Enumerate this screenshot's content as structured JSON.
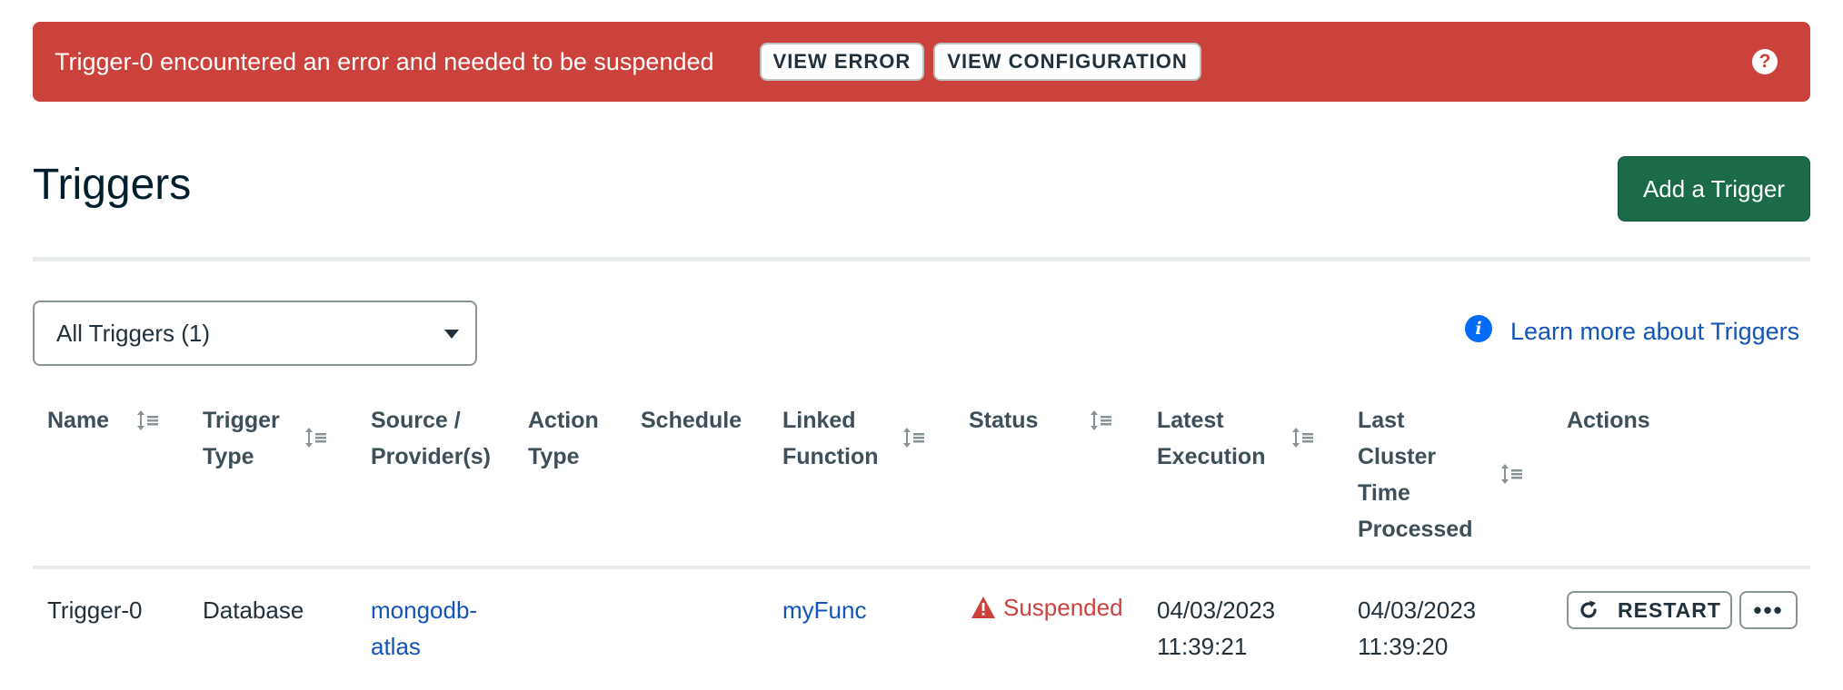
{
  "banner": {
    "message": "Trigger-0 encountered an error and needed to be suspended",
    "view_error_label": "VIEW ERROR",
    "view_config_label": "VIEW CONFIGURATION",
    "help_icon": "question-circle-icon",
    "help_glyph": "?",
    "color": "#cb413b"
  },
  "page": {
    "title": "Triggers",
    "add_button_label": "Add a Trigger",
    "accent": "#1b6b48"
  },
  "filter": {
    "selected": "All Triggers (1)"
  },
  "learn_more": {
    "icon": "info-icon",
    "glyph": "i",
    "label": "Learn more about Triggers"
  },
  "table": {
    "headers": {
      "name": "Name",
      "trigger_type": "Trigger Type",
      "source": "Source / Provider(s)",
      "action_type": "Action Type",
      "schedule": "Schedule",
      "linked_function": "Linked Function",
      "status": "Status",
      "latest_execution": "Latest Execution",
      "last_cluster_time": "Last Cluster Time Processed",
      "actions": "Actions"
    },
    "rows": [
      {
        "name": "Trigger-0",
        "trigger_type": "Database",
        "source": "mongodb-atlas",
        "source_line1": "mongodb-",
        "source_line2": "atlas",
        "action_type": "",
        "schedule": "",
        "linked_function": "myFunc",
        "status": "Suspended",
        "latest_execution_date": "04/03/2023",
        "latest_execution_time": "11:39:21",
        "last_cluster_date": "04/03/2023",
        "last_cluster_time": "11:39:20",
        "restart_label": "RESTART",
        "more_label": "•••"
      }
    ]
  }
}
